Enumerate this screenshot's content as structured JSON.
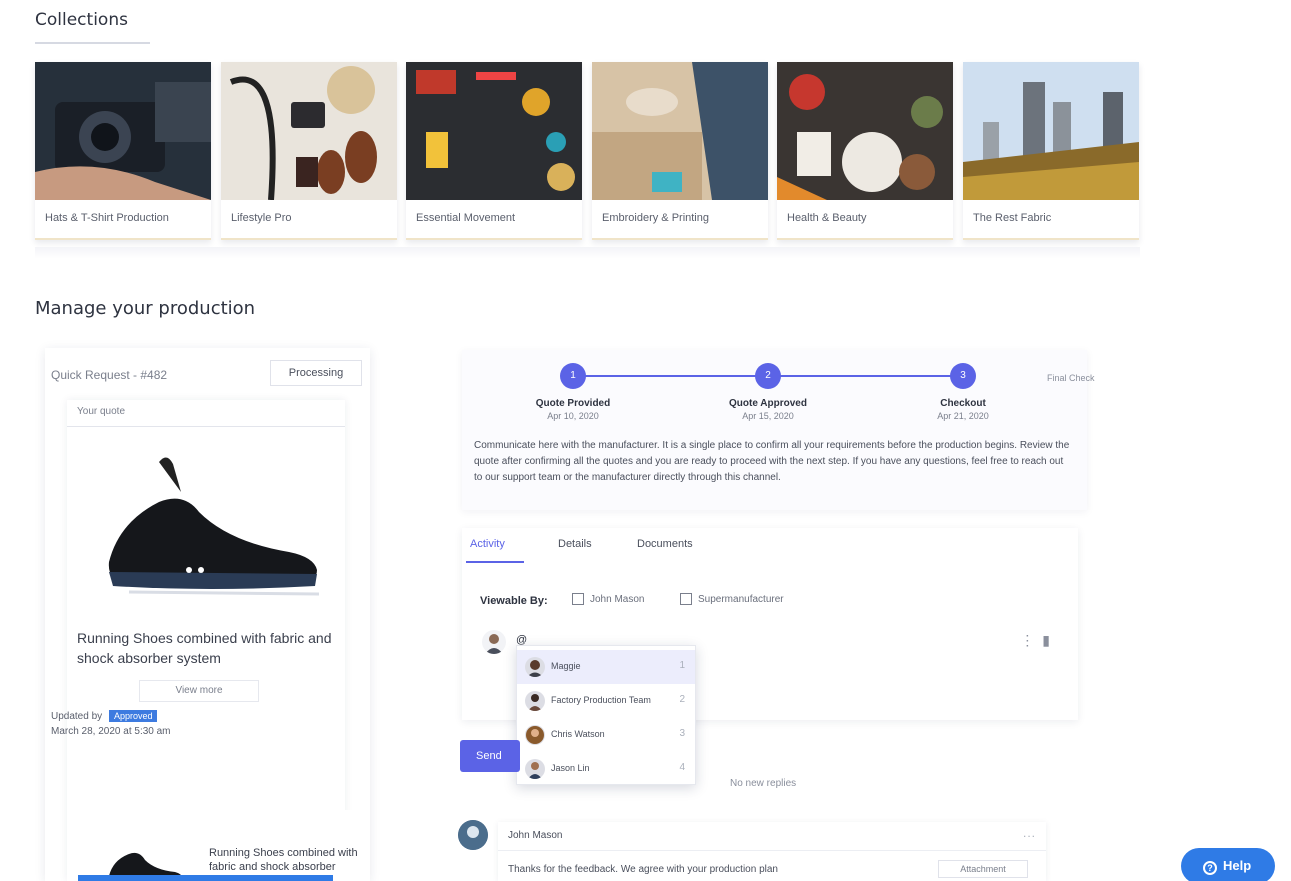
{
  "page": {
    "collections_title": "Collections",
    "manage_title": "Manage your production"
  },
  "collections": [
    {
      "label": "Hats & T-Shirt Production",
      "image": "camera-hands"
    },
    {
      "label": "Lifestyle Pro",
      "image": "accessories-flatlay"
    },
    {
      "label": "Essential Movement",
      "image": "craft-tools"
    },
    {
      "label": "Embroidery & Printing",
      "image": "packing-boxes"
    },
    {
      "label": "Health & Beauty",
      "image": "food-bowls"
    },
    {
      "label": "The Rest Fabric",
      "image": "city-skyline"
    }
  ],
  "sample": {
    "title": "Quick Request - #482",
    "status": "Processing",
    "quote_label": "Your quote",
    "description": "Running Shoes combined with fabric and shock absorber system",
    "view_button": "View more",
    "meta_label": "Updated by",
    "meta_badge": "Approved",
    "meta_date": "March 28, 2020 at 5:30 am",
    "mini_description": "Running Shoes combined with fabric and shock absorber system"
  },
  "stepper": {
    "steps": [
      {
        "number": "1",
        "label": "Quote Provided",
        "date": "Apr 10, 2020"
      },
      {
        "number": "2",
        "label": "Quote Approved",
        "date": "Apr 15, 2020"
      },
      {
        "number": "3",
        "label": "Checkout",
        "date": "Apr 21, 2020"
      }
    ],
    "final_label": "Final Check",
    "description": "Communicate here with the manufacturer. It is a single place to confirm all your requirements before the production begins. Review the quote after confirming all the quotes and you are ready to proceed with the next step. If you have any questions, feel free to reach out to our support team or the manufacturer directly through this channel."
  },
  "activity": {
    "tabs": [
      "Activity",
      "Details",
      "Documents"
    ],
    "active_tab": "Activity",
    "viewable_by_label": "Viewable By:",
    "viewable_options": [
      "John Mason",
      "Supermanufacturer"
    ],
    "input_text": "@",
    "mention_suggestions": [
      {
        "name": "Maggie",
        "role": "1"
      },
      {
        "name": "Factory Production Team",
        "role": "2"
      },
      {
        "name": "Chris Watson",
        "role": "3"
      },
      {
        "name": "Jason Lin",
        "role": "4"
      }
    ],
    "send_label": "Send",
    "thread_hint": "No new replies"
  },
  "reply": {
    "author": "John Mason",
    "more": "...",
    "text": "Thanks for the feedback. We agree with your production plan",
    "chip": "Attachment"
  },
  "help": {
    "label": "Help"
  },
  "colors": {
    "accent": "#5b63e6",
    "brand_blue": "#2f7be6"
  }
}
